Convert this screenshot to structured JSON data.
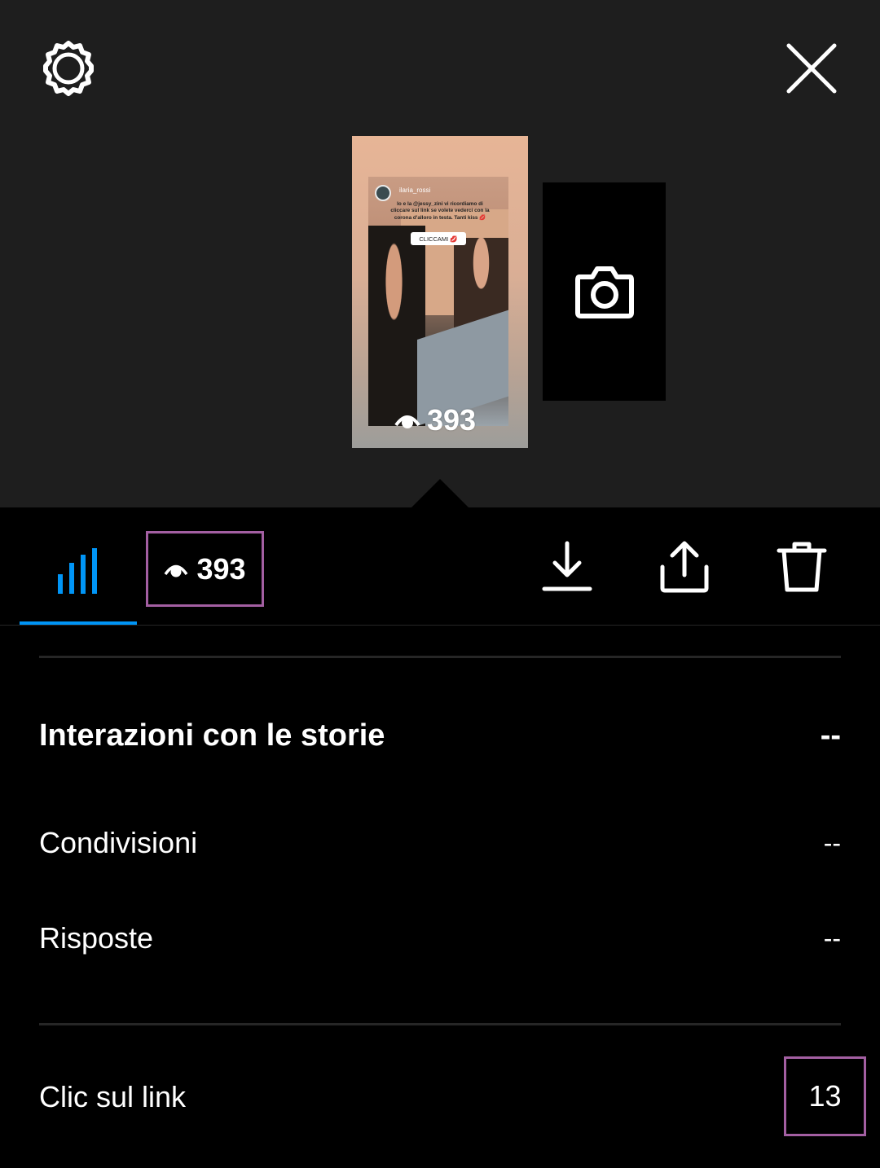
{
  "header": {
    "settings_icon": "gear-icon",
    "close_icon": "close-icon"
  },
  "story": {
    "username": "ilaria_rossi",
    "caption": "Io e la @jessy_zini vi ricordiamo di cliccare sul link se volete vederci con la corona d'alloro in testa. Tanti kiss 💋",
    "sticker_label": "CLICCAMI 💋",
    "views": "393",
    "add_icon": "camera-icon"
  },
  "toolbar": {
    "insights_icon": "bar-chart-icon",
    "views_count": "393",
    "download_icon": "download-icon",
    "share_icon": "share-icon",
    "delete_icon": "trash-icon",
    "accent_color": "#0095f6",
    "highlight_color": "#a35fa2"
  },
  "interactions": {
    "title": "Interazioni con le storie",
    "total": "--",
    "rows": [
      {
        "label": "Condivisioni",
        "value": "--"
      },
      {
        "label": "Risposte",
        "value": "--"
      }
    ]
  },
  "link_clicks": {
    "label": "Clic sul link",
    "value": "13"
  }
}
